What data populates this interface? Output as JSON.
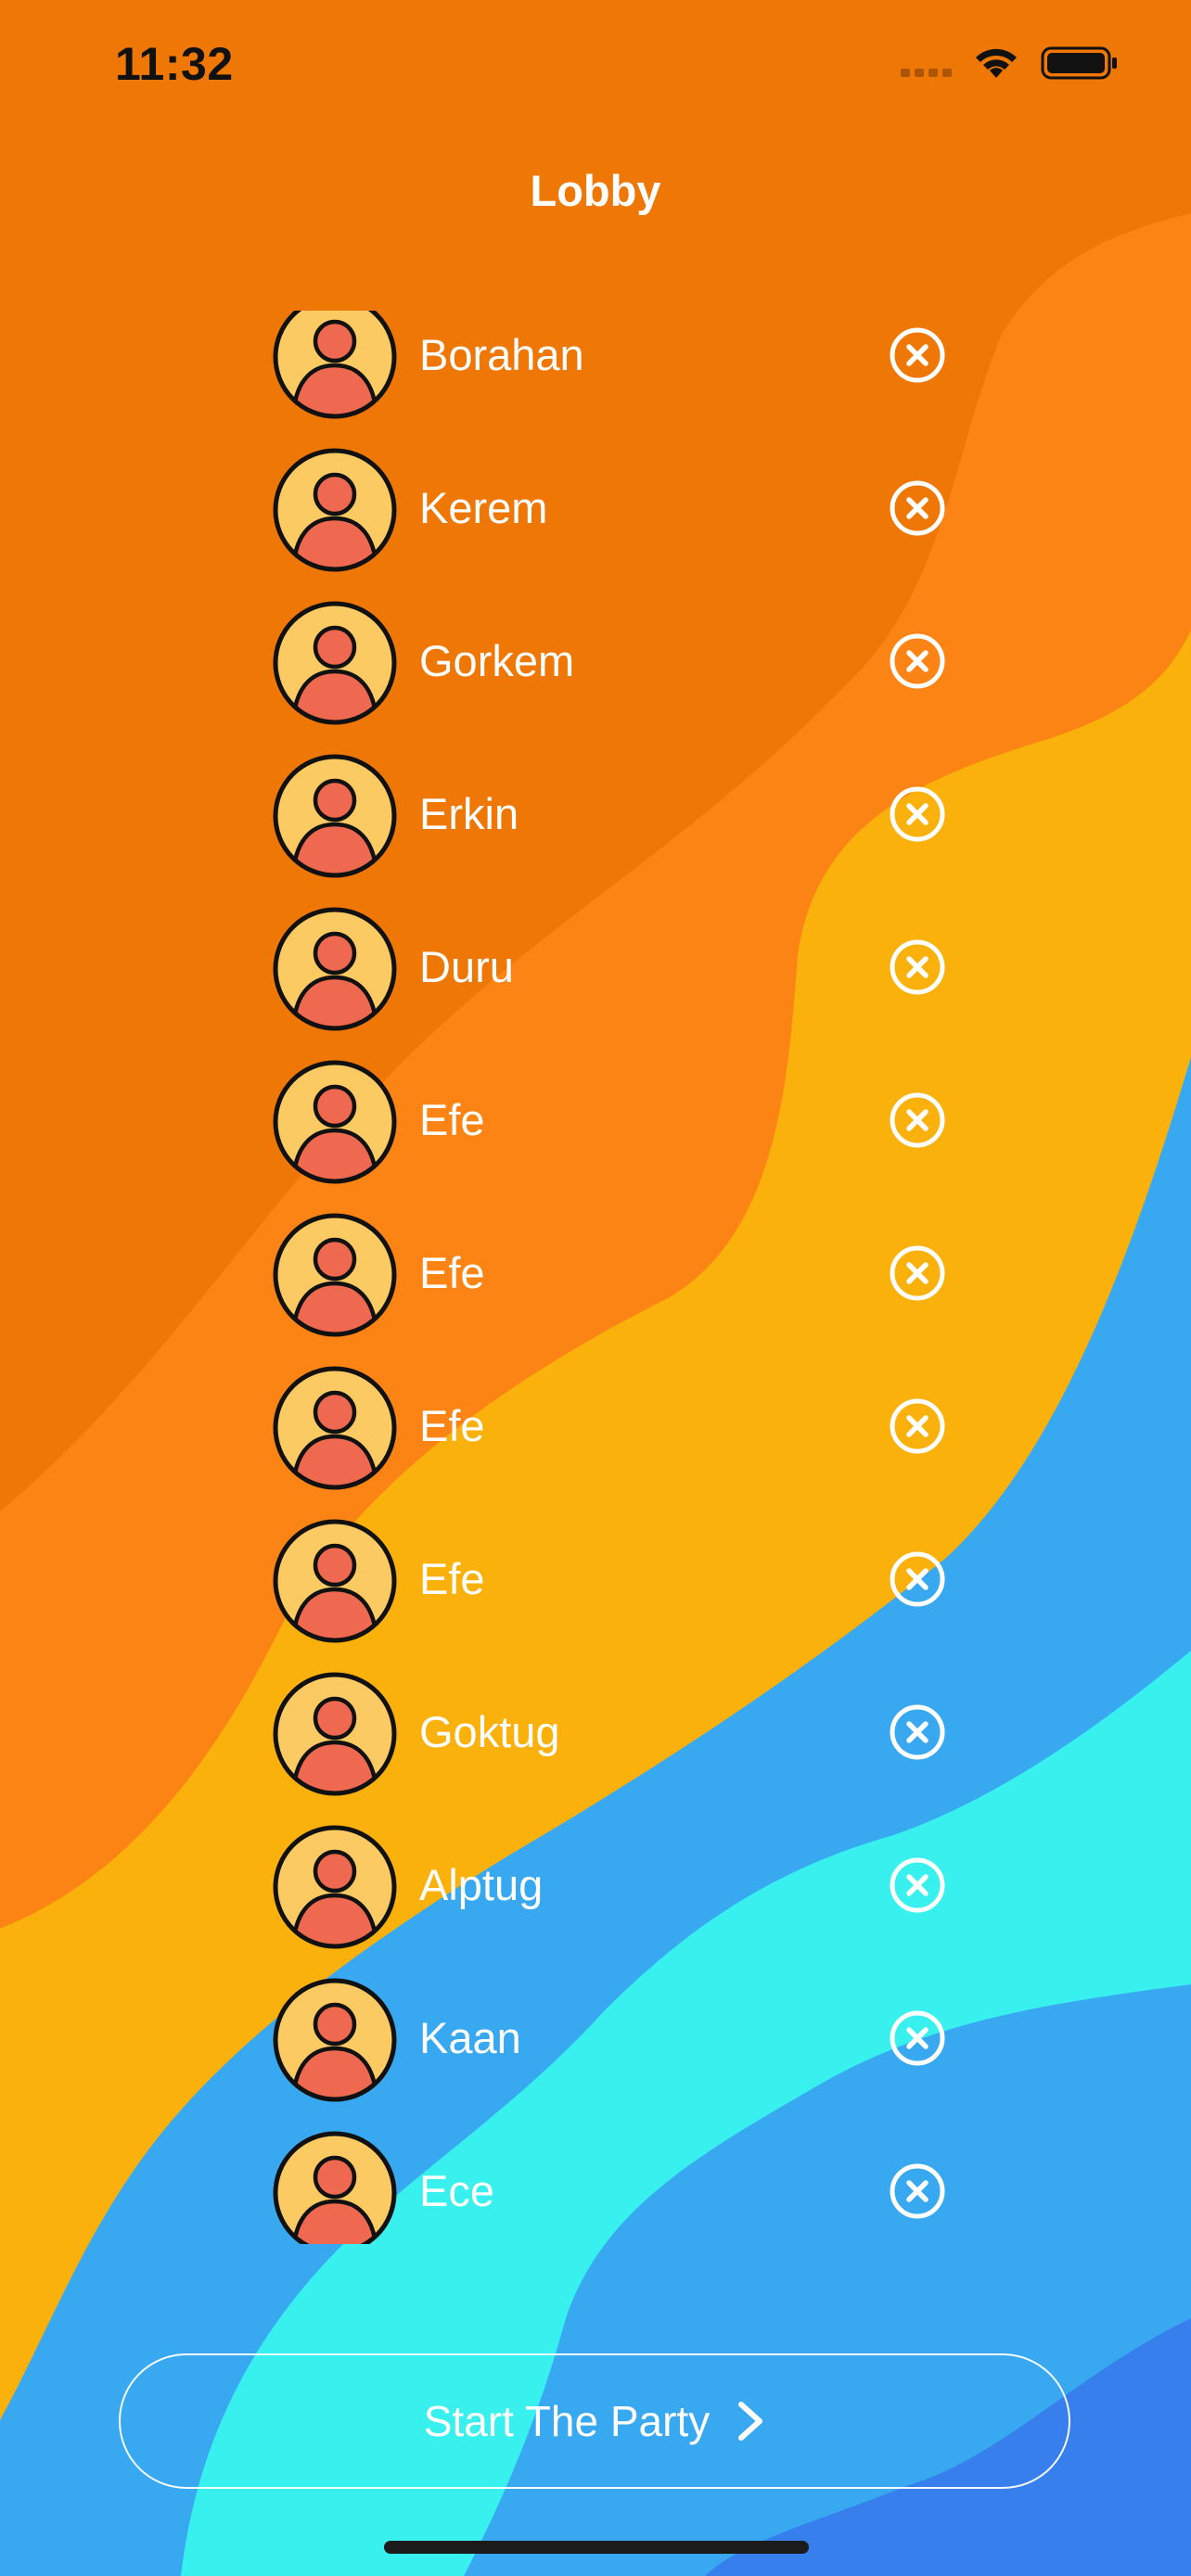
{
  "status_bar": {
    "time": "11:32",
    "signal_icon": "cellular-signal-icon",
    "wifi_icon": "wifi-icon",
    "battery_icon": "battery-icon"
  },
  "nav": {
    "title": "Lobby"
  },
  "players": [
    {
      "name": "Borahan"
    },
    {
      "name": "Kerem"
    },
    {
      "name": "Gorkem"
    },
    {
      "name": "Erkin"
    },
    {
      "name": "Duru"
    },
    {
      "name": "Efe"
    },
    {
      "name": "Efe"
    },
    {
      "name": "Efe"
    },
    {
      "name": "Efe"
    },
    {
      "name": "Goktug"
    },
    {
      "name": "Alptug"
    },
    {
      "name": "Kaan"
    },
    {
      "name": "Ece"
    }
  ],
  "row_icons": {
    "avatar_icon": "user-avatar-icon",
    "remove_icon": "close-circle-icon"
  },
  "start_button": {
    "label": "Start The Party",
    "icon": "chevron-right-icon"
  },
  "colors": {
    "orange_dark": "#EF7705",
    "orange": "#FC8414",
    "yellow": "#FAB10C",
    "blue": "#38A8F1",
    "cyan": "#38F0EE",
    "deep_blue": "#377FED",
    "avatar_face": "#FCCA62",
    "avatar_person": "#EE6950",
    "avatar_outline": "#111111"
  }
}
